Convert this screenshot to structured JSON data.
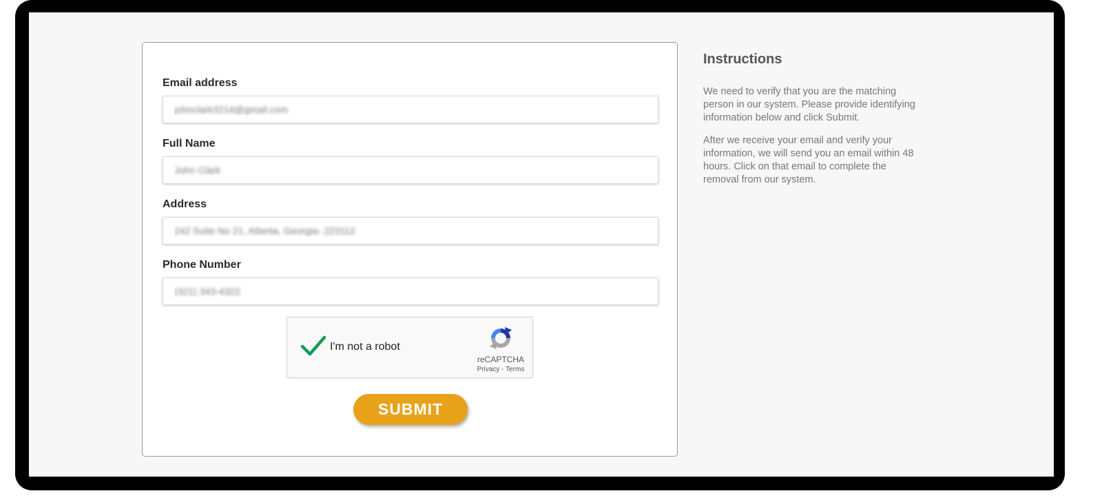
{
  "form": {
    "email": {
      "label": "Email address",
      "value": "johnclark3214@gmail.com"
    },
    "full_name": {
      "label": "Full Name",
      "value": "John Clark"
    },
    "address": {
      "label": "Address",
      "value": "242 Suite No 21, Atlanta, Georgia- 223112"
    },
    "phone": {
      "label": "Phone Number",
      "value": "(321) 343-4322"
    }
  },
  "recaptcha": {
    "label": "I'm not a robot",
    "checked": true,
    "brand": "reCAPTCHA",
    "privacy": "Privacy",
    "separator": " - ",
    "terms": "Terms",
    "check_color": "#0f9d58"
  },
  "submit": {
    "label": "SUBMIT",
    "color": "#e8a21a"
  },
  "instructions": {
    "title": "Instructions",
    "paragraphs": [
      "We need to verify that you are the matching person in our system. Please provide identifying information below and click Submit.",
      "After we receive your email and verify your information, we will send you an email within 48 hours. Click on that email to complete the removal from our system."
    ]
  }
}
